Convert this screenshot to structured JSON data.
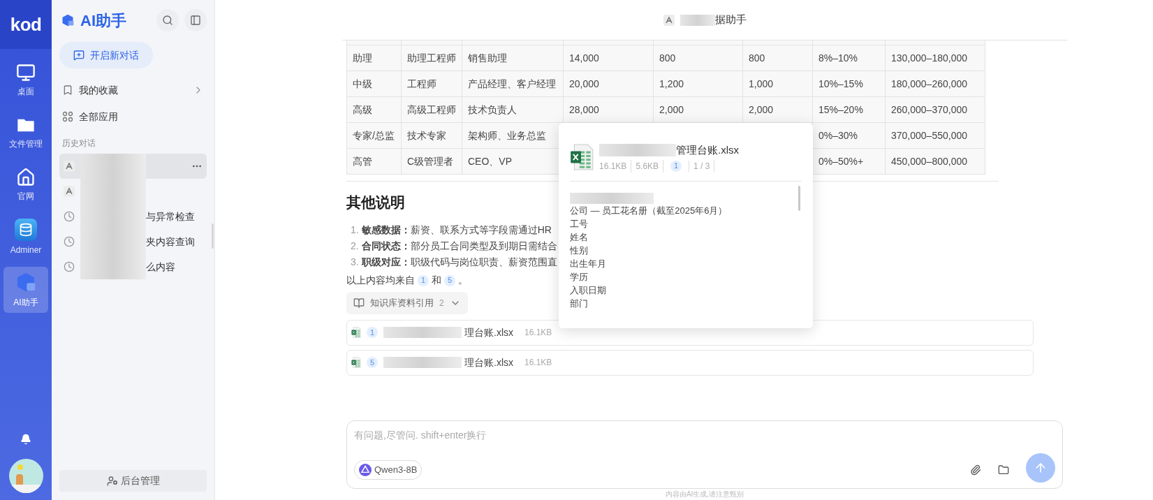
{
  "rail": {
    "logo": "kod",
    "items": [
      {
        "label": "桌面",
        "kind": "monitor",
        "selected": false
      },
      {
        "label": "文件管理",
        "kind": "folder",
        "selected": false
      },
      {
        "label": "官网",
        "kind": "home",
        "selected": false
      },
      {
        "label": "Adminer",
        "kind": "database",
        "selected": false
      },
      {
        "label": "AI助手",
        "kind": "ai",
        "selected": true
      }
    ]
  },
  "sidebar": {
    "title": "AI助手",
    "new_chat": "开启新对话",
    "links": [
      {
        "label": "我的收藏",
        "kind": "bookmark"
      },
      {
        "label": "全部应用",
        "kind": "apps"
      }
    ],
    "history_heading": "历史对话",
    "history": [
      {
        "kind": "assistant",
        "selected": true
      },
      {
        "kind": "assistant",
        "selected": false
      },
      {
        "kind": "chat",
        "label": "与异常检查",
        "selected": false
      },
      {
        "kind": "chat",
        "label": "夹内容查询",
        "selected": false
      },
      {
        "kind": "chat",
        "label": "么内容",
        "selected": false
      }
    ],
    "admin": "后台管理"
  },
  "chat": {
    "title": "据助手",
    "table": {
      "rows": [
        {
          "cells": [
            "助理",
            "助理工程师",
            "销售助理",
            "14,000",
            "800",
            "800",
            "8%–10%",
            "130,000–180,000"
          ]
        },
        {
          "cells": [
            "中级",
            "工程师",
            "产品经理、客户经理",
            "20,000",
            "1,200",
            "1,000",
            "10%–15%",
            "180,000–260,000"
          ]
        },
        {
          "cells": [
            "高级",
            "高级工程师",
            "技术负责人",
            "28,000",
            "2,000",
            "2,000",
            "15%–20%",
            "260,000–370,000"
          ]
        },
        {
          "cells": [
            "专家/总监",
            "技术专家",
            "架构师、业务总监",
            null,
            null,
            null,
            "0%–30%",
            "370,000–550,000"
          ]
        },
        {
          "cells": [
            "高管",
            "C级管理者",
            "CEO、VP",
            null,
            null,
            null,
            "0%–50%+",
            "450,000–800,000"
          ]
        }
      ]
    },
    "heading": "其他说明",
    "notes": [
      {
        "marker": "1.",
        "text": "**敏感数据：**薪资、联系方式等字段需通过HR"
      },
      {
        "marker": "2.",
        "text": "**合同状态：**部分员工合同类型及到期日需结合"
      },
      {
        "marker": "3.",
        "text": "**职级对应：**职级代码与岗位职责、薪资范围直"
      }
    ],
    "sources": {
      "before": "以上内容均来自",
      "first_ref": "1",
      "between": "和",
      "second_ref": "5",
      "after": "。"
    },
    "kb_toggle": {
      "label": "知识库资料引用",
      "count": "2",
      "expanded": false
    },
    "files": [
      {
        "ref": "1",
        "name": "理台账.xlsx",
        "size": "16.1KB"
      },
      {
        "ref": "5",
        "name": "理台账.xlsx",
        "size": "16.1KB"
      }
    ]
  },
  "preview": {
    "name": "管理台账.xlsx",
    "size": "16.1KB",
    "size_2": "5.6KB",
    "ref": "1",
    "page": "1 / 3",
    "lines": [
      "公司 — 员工花名册（截至2025年6月）",
      "工号",
      "姓名",
      "性别",
      "出生年月",
      "学历",
      "入职日期",
      "部门"
    ]
  },
  "composer": {
    "placeholder": "有问题,尽管问. shift+enter换行",
    "model": "Qwen3-8B"
  },
  "footer": "内容由AI生成,请注意甄别"
}
